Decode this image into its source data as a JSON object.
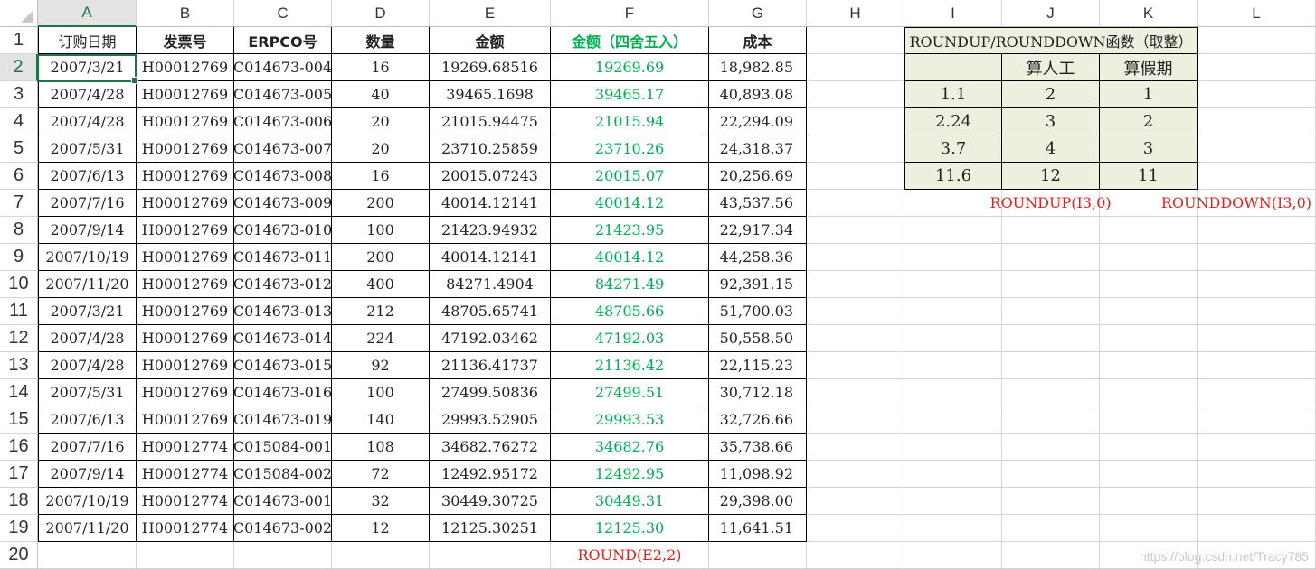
{
  "columns": [
    "A",
    "B",
    "C",
    "D",
    "E",
    "F",
    "G",
    "H",
    "I",
    "J",
    "K",
    "L"
  ],
  "rows": [
    "1",
    "2",
    "3",
    "4",
    "5",
    "6",
    "7",
    "8",
    "9",
    "10",
    "11",
    "12",
    "13",
    "14",
    "15",
    "16",
    "17",
    "18",
    "19",
    "20"
  ],
  "headers": [
    "订购日期",
    "发票号",
    "ERPCO号",
    "数量",
    "金额",
    "金额（四舍五入）",
    "成本"
  ],
  "records": [
    [
      "2007/3/21",
      "H00012769",
      "C014673-004",
      "16",
      "19269.68516",
      "19269.69",
      "18,982.85"
    ],
    [
      "2007/4/28",
      "H00012769",
      "C014673-005",
      "40",
      "39465.1698",
      "39465.17",
      "40,893.08"
    ],
    [
      "2007/4/28",
      "H00012769",
      "C014673-006",
      "20",
      "21015.94475",
      "21015.94",
      "22,294.09"
    ],
    [
      "2007/5/31",
      "H00012769",
      "C014673-007",
      "20",
      "23710.25859",
      "23710.26",
      "24,318.37"
    ],
    [
      "2007/6/13",
      "H00012769",
      "C014673-008",
      "16",
      "20015.07243",
      "20015.07",
      "20,256.69"
    ],
    [
      "2007/7/16",
      "H00012769",
      "C014673-009",
      "200",
      "40014.12141",
      "40014.12",
      "43,537.56"
    ],
    [
      "2007/9/14",
      "H00012769",
      "C014673-010",
      "100",
      "21423.94932",
      "21423.95",
      "22,917.34"
    ],
    [
      "2007/10/19",
      "H00012769",
      "C014673-011",
      "200",
      "40014.12141",
      "40014.12",
      "44,258.36"
    ],
    [
      "2007/11/20",
      "H00012769",
      "C014673-012",
      "400",
      "84271.4904",
      "84271.49",
      "92,391.15"
    ],
    [
      "2007/3/21",
      "H00012769",
      "C014673-013",
      "212",
      "48705.65741",
      "48705.66",
      "51,700.03"
    ],
    [
      "2007/4/28",
      "H00012769",
      "C014673-014",
      "224",
      "47192.03462",
      "47192.03",
      "50,558.50"
    ],
    [
      "2007/4/28",
      "H00012769",
      "C014673-015",
      "92",
      "21136.41737",
      "21136.42",
      "22,115.23"
    ],
    [
      "2007/5/31",
      "H00012769",
      "C014673-016",
      "100",
      "27499.50836",
      "27499.51",
      "30,712.18"
    ],
    [
      "2007/6/13",
      "H00012769",
      "C014673-019",
      "140",
      "29993.52905",
      "29993.53",
      "32,726.66"
    ],
    [
      "2007/7/16",
      "H00012774",
      "C015084-001",
      "108",
      "34682.76272",
      "34682.76",
      "35,738.66"
    ],
    [
      "2007/9/14",
      "H00012774",
      "C015084-002",
      "72",
      "12492.95172",
      "12492.95",
      "11,098.92"
    ],
    [
      "2007/10/19",
      "H00012774",
      "C014673-001",
      "32",
      "30449.30725",
      "30449.31",
      "29,398.00"
    ],
    [
      "2007/11/20",
      "H00012774",
      "C014673-002",
      "12",
      "12125.30251",
      "12125.30",
      "11,641.51"
    ]
  ],
  "round_note": "ROUND(E2,2)",
  "right_table": {
    "title": "ROUNDUP/ROUNDDOWN函数（取整）",
    "col_headers": [
      "",
      "算人工",
      "算假期"
    ],
    "rows": [
      [
        "1.1",
        "2",
        "1"
      ],
      [
        "2.24",
        "3",
        "2"
      ],
      [
        "3.7",
        "4",
        "3"
      ],
      [
        "11.6",
        "12",
        "11"
      ]
    ],
    "note_up": "ROUNDUP(I3,0)",
    "note_down": "ROUNDDOWN(I3,0)"
  },
  "watermark": "https://blog.csdn.net/Tracy785",
  "colors": {
    "green": "#00b050",
    "red": "#e02020",
    "select": "#217346",
    "table_fill": "#ebf1de"
  }
}
